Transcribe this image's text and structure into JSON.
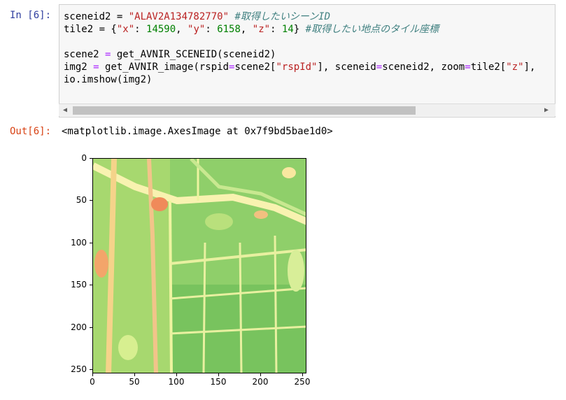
{
  "input_cell": {
    "prompt": "In [6]:",
    "lines": [
      [
        {
          "t": "sceneid2 = "
        },
        {
          "t": "\"ALAV2A134782770\"",
          "c": "kw-str"
        },
        {
          "t": " "
        },
        {
          "t": "#取得したいシーンID",
          "c": "kw-com"
        }
      ],
      [
        {
          "t": "tile2 = {"
        },
        {
          "t": "\"x\"",
          "c": "kw-str"
        },
        {
          "t": ": "
        },
        {
          "t": "14590",
          "c": "kw-num"
        },
        {
          "t": ", "
        },
        {
          "t": "\"y\"",
          "c": "kw-str"
        },
        {
          "t": ": "
        },
        {
          "t": "6158",
          "c": "kw-num"
        },
        {
          "t": ", "
        },
        {
          "t": "\"z\"",
          "c": "kw-str"
        },
        {
          "t": ": "
        },
        {
          "t": "14",
          "c": "kw-num"
        },
        {
          "t": "} "
        },
        {
          "t": "#取得したい地点のタイル座標",
          "c": "kw-com"
        }
      ],
      [
        {
          "t": ""
        }
      ],
      [
        {
          "t": "scene2 "
        },
        {
          "t": "=",
          "c": "kw-op"
        },
        {
          "t": " get_AVNIR_SCENEID(sceneid2)"
        }
      ],
      [
        {
          "t": "img2 "
        },
        {
          "t": "=",
          "c": "kw-op"
        },
        {
          "t": " get_AVNIR_image(rspid"
        },
        {
          "t": "=",
          "c": "kw-op"
        },
        {
          "t": "scene2["
        },
        {
          "t": "\"rspId\"",
          "c": "kw-str"
        },
        {
          "t": "], sceneid"
        },
        {
          "t": "=",
          "c": "kw-op"
        },
        {
          "t": "sceneid2, zoom"
        },
        {
          "t": "=",
          "c": "kw-op"
        },
        {
          "t": "tile2["
        },
        {
          "t": "\"z\"",
          "c": "kw-str"
        },
        {
          "t": "],"
        }
      ],
      [
        {
          "t": "io.imshow(img2)"
        }
      ]
    ]
  },
  "output_cell": {
    "prompt": "Out[6]:",
    "text": "<matplotlib.image.AxesImage at 0x7f9bd5bae1d0>"
  },
  "scrollbar": {
    "left_arrow": "◀",
    "right_arrow": "▶"
  },
  "chart_data": {
    "type": "heatmap",
    "title": "",
    "xlabel": "",
    "ylabel": "",
    "xlim": [
      0,
      255
    ],
    "ylim": [
      255,
      0
    ],
    "x_ticks": [
      "0",
      "50",
      "100",
      "150",
      "200",
      "250"
    ],
    "y_ticks": [
      "0",
      "50",
      "100",
      "150",
      "200",
      "250"
    ],
    "colormap": "RdYlGn"
  }
}
